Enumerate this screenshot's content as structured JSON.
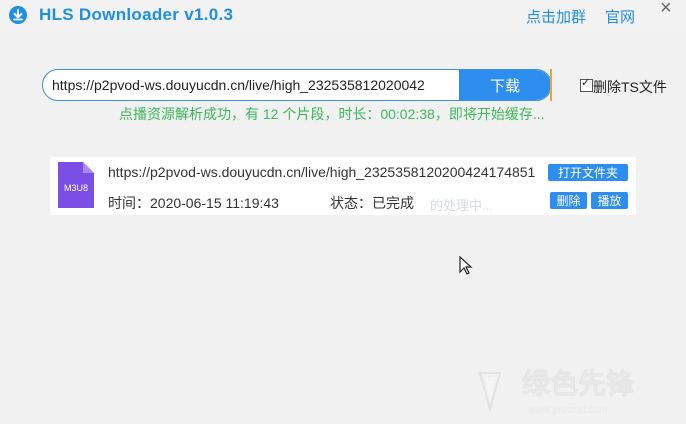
{
  "app": {
    "title": "HLS Downloader v1.0.3",
    "links": [
      "点击加群",
      "官网"
    ],
    "close_label": "×"
  },
  "input": {
    "url_value": "https://p2pvod-ws.douyucdn.cn/live/high_232535812020042",
    "download_label": "下载",
    "delete_ts_label": "删除TS文件",
    "delete_ts_checked": true
  },
  "status_message": "点播资源解析成功，有 12 个片段，时长：00:02:38，即将开始缓存...",
  "task": {
    "file_type": "M3U8",
    "url": "https://p2pvod-ws.douyucdn.cn/live/high_2325358120200424174851",
    "time_label": "时间：2020-06-15 11:19:43",
    "status_label": "状态：已完成",
    "ghost_text": "的处理中...",
    "buttons": {
      "open_folder": "打开文件夹",
      "delete": "删除",
      "play": "播放"
    }
  },
  "watermark": {
    "text": "绿色先锋",
    "url": "www.greenxf.com"
  },
  "colors": {
    "accent": "#2e8ef0",
    "title_blue": "#1f8fe4",
    "success_green": "#3bb85a",
    "file_icon_purple": "#7b4ee6",
    "input_edge_orange": "#e8a33a"
  }
}
